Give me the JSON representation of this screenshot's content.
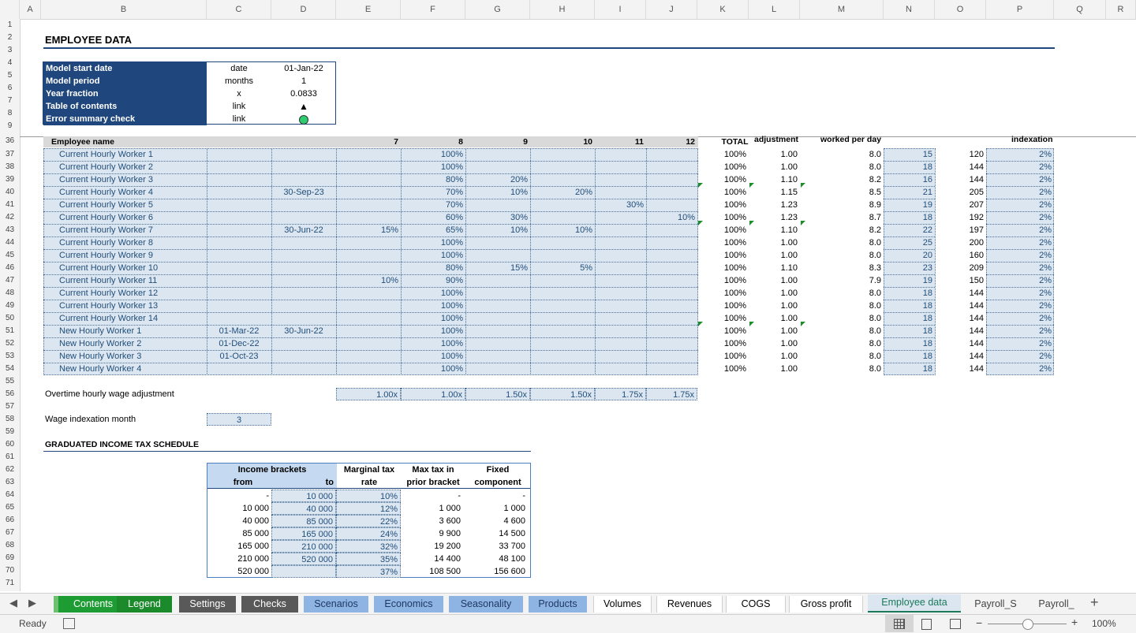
{
  "columns": [
    "A",
    "B",
    "C",
    "D",
    "E",
    "F",
    "G",
    "H",
    "I",
    "J",
    "K",
    "L",
    "M",
    "N",
    "O",
    "P",
    "Q",
    "R"
  ],
  "rows_top": [
    "1",
    "2",
    "3",
    "4",
    "5",
    "6",
    "7",
    "8",
    "9"
  ],
  "rows_main": [
    "36",
    "37",
    "38",
    "39",
    "40",
    "41",
    "42",
    "43",
    "44",
    "45",
    "46",
    "47",
    "48",
    "49",
    "50",
    "51",
    "52",
    "53",
    "54",
    "55",
    "56",
    "57",
    "58",
    "59",
    "60",
    "61",
    "62",
    "63",
    "64",
    "65",
    "66",
    "67",
    "68",
    "69",
    "70",
    "71"
  ],
  "title": "EMPLOYEE DATA",
  "info": [
    {
      "label": "Model start date",
      "unit": "date",
      "value": "01-Jan-22"
    },
    {
      "label": "Model period",
      "unit": "months",
      "value": "1"
    },
    {
      "label": "Year fraction",
      "unit": "x",
      "value": "0.0833"
    },
    {
      "label": "Table of contents",
      "unit": "link",
      "value": "▲"
    },
    {
      "label": "Error summary check",
      "unit": "link",
      "value": ""
    }
  ],
  "header_row": {
    "name": "Employee name",
    "e": "7",
    "f": "8",
    "g": "9",
    "h": "10",
    "i": "11",
    "j": "12",
    "k": "TOTAL",
    "l": "adjustment",
    "m": "worked per day",
    "p": "indexation"
  },
  "employees": [
    {
      "name": "Current Hourly Worker 1",
      "c": "",
      "d": "",
      "e": "",
      "f": "100%",
      "g": "",
      "h": "",
      "i": "",
      "j": "",
      "k": "100%",
      "l": "1.00",
      "m": "8.0",
      "n": "15",
      "o": "120",
      "p": "2%"
    },
    {
      "name": "Current Hourly Worker 2",
      "c": "",
      "d": "",
      "e": "",
      "f": "100%",
      "g": "",
      "h": "",
      "i": "",
      "j": "",
      "k": "100%",
      "l": "1.00",
      "m": "8.0",
      "n": "18",
      "o": "144",
      "p": "2%"
    },
    {
      "name": "Current Hourly Worker 3",
      "c": "",
      "d": "",
      "e": "",
      "f": "80%",
      "g": "20%",
      "h": "",
      "i": "",
      "j": "",
      "k": "100%",
      "l": "1.10",
      "m": "8.2",
      "n": "16",
      "o": "144",
      "p": "2%"
    },
    {
      "name": "Current Hourly Worker 4",
      "c": "",
      "d": "30-Sep-23",
      "e": "",
      "f": "70%",
      "g": "10%",
      "h": "20%",
      "i": "",
      "j": "",
      "k": "100%",
      "l": "1.15",
      "m": "8.5",
      "n": "21",
      "o": "205",
      "p": "2%"
    },
    {
      "name": "Current Hourly Worker 5",
      "c": "",
      "d": "",
      "e": "",
      "f": "70%",
      "g": "",
      "h": "",
      "i": "30%",
      "j": "",
      "k": "100%",
      "l": "1.23",
      "m": "8.9",
      "n": "19",
      "o": "207",
      "p": "2%"
    },
    {
      "name": "Current Hourly Worker 6",
      "c": "",
      "d": "",
      "e": "",
      "f": "60%",
      "g": "30%",
      "h": "",
      "i": "",
      "j": "10%",
      "k": "100%",
      "l": "1.23",
      "m": "8.7",
      "n": "18",
      "o": "192",
      "p": "2%"
    },
    {
      "name": "Current Hourly Worker 7",
      "c": "",
      "d": "30-Jun-22",
      "e": "15%",
      "f": "65%",
      "g": "10%",
      "h": "10%",
      "i": "",
      "j": "",
      "k": "100%",
      "l": "1.10",
      "m": "8.2",
      "n": "22",
      "o": "197",
      "p": "2%"
    },
    {
      "name": "Current Hourly Worker 8",
      "c": "",
      "d": "",
      "e": "",
      "f": "100%",
      "g": "",
      "h": "",
      "i": "",
      "j": "",
      "k": "100%",
      "l": "1.00",
      "m": "8.0",
      "n": "25",
      "o": "200",
      "p": "2%"
    },
    {
      "name": "Current Hourly Worker 9",
      "c": "",
      "d": "",
      "e": "",
      "f": "100%",
      "g": "",
      "h": "",
      "i": "",
      "j": "",
      "k": "100%",
      "l": "1.00",
      "m": "8.0",
      "n": "20",
      "o": "160",
      "p": "2%"
    },
    {
      "name": "Current Hourly Worker 10",
      "c": "",
      "d": "",
      "e": "",
      "f": "80%",
      "g": "15%",
      "h": "5%",
      "i": "",
      "j": "",
      "k": "100%",
      "l": "1.10",
      "m": "8.3",
      "n": "23",
      "o": "209",
      "p": "2%"
    },
    {
      "name": "Current Hourly Worker 11",
      "c": "",
      "d": "",
      "e": "10%",
      "f": "90%",
      "g": "",
      "h": "",
      "i": "",
      "j": "",
      "k": "100%",
      "l": "1.00",
      "m": "7.9",
      "n": "19",
      "o": "150",
      "p": "2%"
    },
    {
      "name": "Current Hourly Worker 12",
      "c": "",
      "d": "",
      "e": "",
      "f": "100%",
      "g": "",
      "h": "",
      "i": "",
      "j": "",
      "k": "100%",
      "l": "1.00",
      "m": "8.0",
      "n": "18",
      "o": "144",
      "p": "2%"
    },
    {
      "name": "Current Hourly Worker 13",
      "c": "",
      "d": "",
      "e": "",
      "f": "100%",
      "g": "",
      "h": "",
      "i": "",
      "j": "",
      "k": "100%",
      "l": "1.00",
      "m": "8.0",
      "n": "18",
      "o": "144",
      "p": "2%"
    },
    {
      "name": "Current Hourly Worker 14",
      "c": "",
      "d": "",
      "e": "",
      "f": "100%",
      "g": "",
      "h": "",
      "i": "",
      "j": "",
      "k": "100%",
      "l": "1.00",
      "m": "8.0",
      "n": "18",
      "o": "144",
      "p": "2%"
    },
    {
      "name": "New Hourly Worker 1",
      "c": "01-Mar-22",
      "d": "30-Jun-22",
      "e": "",
      "f": "100%",
      "g": "",
      "h": "",
      "i": "",
      "j": "",
      "k": "100%",
      "l": "1.00",
      "m": "8.0",
      "n": "18",
      "o": "144",
      "p": "2%"
    },
    {
      "name": "New Hourly Worker 2",
      "c": "01-Dec-22",
      "d": "",
      "e": "",
      "f": "100%",
      "g": "",
      "h": "",
      "i": "",
      "j": "",
      "k": "100%",
      "l": "1.00",
      "m": "8.0",
      "n": "18",
      "o": "144",
      "p": "2%"
    },
    {
      "name": "New Hourly Worker 3",
      "c": "01-Oct-23",
      "d": "",
      "e": "",
      "f": "100%",
      "g": "",
      "h": "",
      "i": "",
      "j": "",
      "k": "100%",
      "l": "1.00",
      "m": "8.0",
      "n": "18",
      "o": "144",
      "p": "2%"
    },
    {
      "name": "New Hourly Worker 4",
      "c": "",
      "d": "",
      "e": "",
      "f": "100%",
      "g": "",
      "h": "",
      "i": "",
      "j": "",
      "k": "100%",
      "l": "1.00",
      "m": "8.0",
      "n": "18",
      "o": "144",
      "p": "2%"
    }
  ],
  "overtime": {
    "label": "Overtime hourly wage adjustment",
    "values": [
      "1.00x",
      "1.00x",
      "1.50x",
      "1.50x",
      "1.75x",
      "1.75x"
    ]
  },
  "wage_index": {
    "label": "Wage indexation month",
    "value": "3"
  },
  "tax": {
    "title": "GRADUATED INCOME TAX SCHEDULE",
    "h1": {
      "brackets": "Income brackets",
      "marginal": "Marginal tax",
      "max": "Max tax in",
      "fixed": "Fixed"
    },
    "h2": {
      "from": "from",
      "to": "to",
      "rate": "rate",
      "prior": "prior bracket",
      "component": "component"
    },
    "rows": [
      {
        "from": "-",
        "to": "10 000",
        "rate": "10%",
        "max": "-",
        "fixed": "-"
      },
      {
        "from": "10 000",
        "to": "40 000",
        "rate": "12%",
        "max": "1 000",
        "fixed": "1 000"
      },
      {
        "from": "40 000",
        "to": "85 000",
        "rate": "22%",
        "max": "3 600",
        "fixed": "4 600"
      },
      {
        "from": "85 000",
        "to": "165 000",
        "rate": "24%",
        "max": "9 900",
        "fixed": "14 500"
      },
      {
        "from": "165 000",
        "to": "210 000",
        "rate": "32%",
        "max": "19 200",
        "fixed": "33 700"
      },
      {
        "from": "210 000",
        "to": "520 000",
        "rate": "35%",
        "max": "14 400",
        "fixed": "48 100"
      },
      {
        "from": "520 000",
        "to": "",
        "rate": "37%",
        "max": "108 500",
        "fixed": "156 600"
      }
    ]
  },
  "tabs": [
    {
      "label": "Contents",
      "bg": "#1e9c34",
      "fg": "#ffffff"
    },
    {
      "label": "Legend",
      "bg": "#1a8a2b",
      "fg": "#ffffff"
    },
    {
      "label": "Settings",
      "bg": "#595959",
      "fg": "#ffffff"
    },
    {
      "label": "Checks",
      "bg": "#595959",
      "fg": "#ffffff"
    },
    {
      "label": "Scenarios",
      "bg": "#8eb4e3",
      "fg": "#1f3864"
    },
    {
      "label": "Economics",
      "bg": "#8eb4e3",
      "fg": "#1f3864"
    },
    {
      "label": "Seasonality",
      "bg": "#8eb4e3",
      "fg": "#1f3864"
    },
    {
      "label": "Products",
      "bg": "#8eb4e3",
      "fg": "#1f3864"
    },
    {
      "label": "Volumes",
      "bg": "#ffffff",
      "fg": "#000000"
    },
    {
      "label": "Revenues",
      "bg": "#ffffff",
      "fg": "#000000"
    },
    {
      "label": "COGS",
      "bg": "#ffffff",
      "fg": "#000000"
    },
    {
      "label": "Gross profit",
      "bg": "#ffffff",
      "fg": "#000000"
    },
    {
      "label": "Employee data",
      "bg": "#dce6f1",
      "fg": "#1a7a5a",
      "active": true
    },
    {
      "label": "Payroll_S",
      "bg": "#f3f3f3",
      "fg": "#444444"
    },
    {
      "label": "Payroll_",
      "bg": "#f3f3f3",
      "fg": "#444444"
    }
  ],
  "status": {
    "ready": "Ready",
    "zoom": "100%",
    "zoom_level": 0.5
  },
  "colors": {
    "accent": "#1f477d",
    "input_bg": "#dce6f1",
    "input_fg": "#1f4e79",
    "ok_green": "#2ecc71"
  }
}
